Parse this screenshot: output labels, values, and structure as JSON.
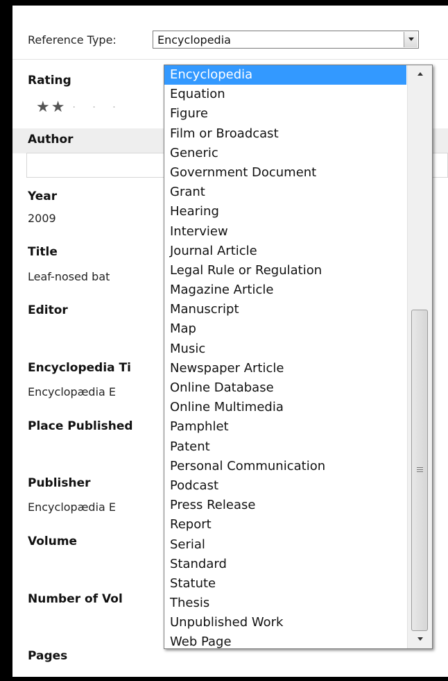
{
  "reference_type": {
    "label": "Reference Type:",
    "value": "Encyclopedia"
  },
  "fields": {
    "rating_label": "Rating",
    "rating_stars": 2,
    "rating_max": 5,
    "author_label": "Author",
    "author_value": "",
    "year_label": "Year",
    "year_value": "2009",
    "title_label": "Title",
    "title_value": "Leaf-nosed bat",
    "editor_label": "Editor",
    "encyclopedia_title_label": "Encyclopedia Ti",
    "encyclopedia_title_value": "Encyclopædia E",
    "place_published_label": "Place Published",
    "publisher_label": "Publisher",
    "publisher_value": "Encyclopædia E",
    "volume_label": "Volume",
    "number_of_volumes_label": "Number of Vol",
    "pages_label": "Pages"
  },
  "dropdown": {
    "selected": "Encyclopedia",
    "options": [
      "Encyclopedia",
      "Equation",
      "Figure",
      "Film or Broadcast",
      "Generic",
      "Government Document",
      "Grant",
      "Hearing",
      "Interview",
      "Journal Article",
      "Legal Rule or Regulation",
      "Magazine Article",
      "Manuscript",
      "Map",
      "Music",
      "Newspaper Article",
      "Online Database",
      "Online Multimedia",
      "Pamphlet",
      "Patent",
      "Personal Communication",
      "Podcast",
      "Press Release",
      "Report",
      "Serial",
      "Standard",
      "Statute",
      "Thesis",
      "Unpublished Work",
      "Web Page"
    ]
  },
  "colors": {
    "selection": "#3399ff",
    "frame": "#000000"
  }
}
